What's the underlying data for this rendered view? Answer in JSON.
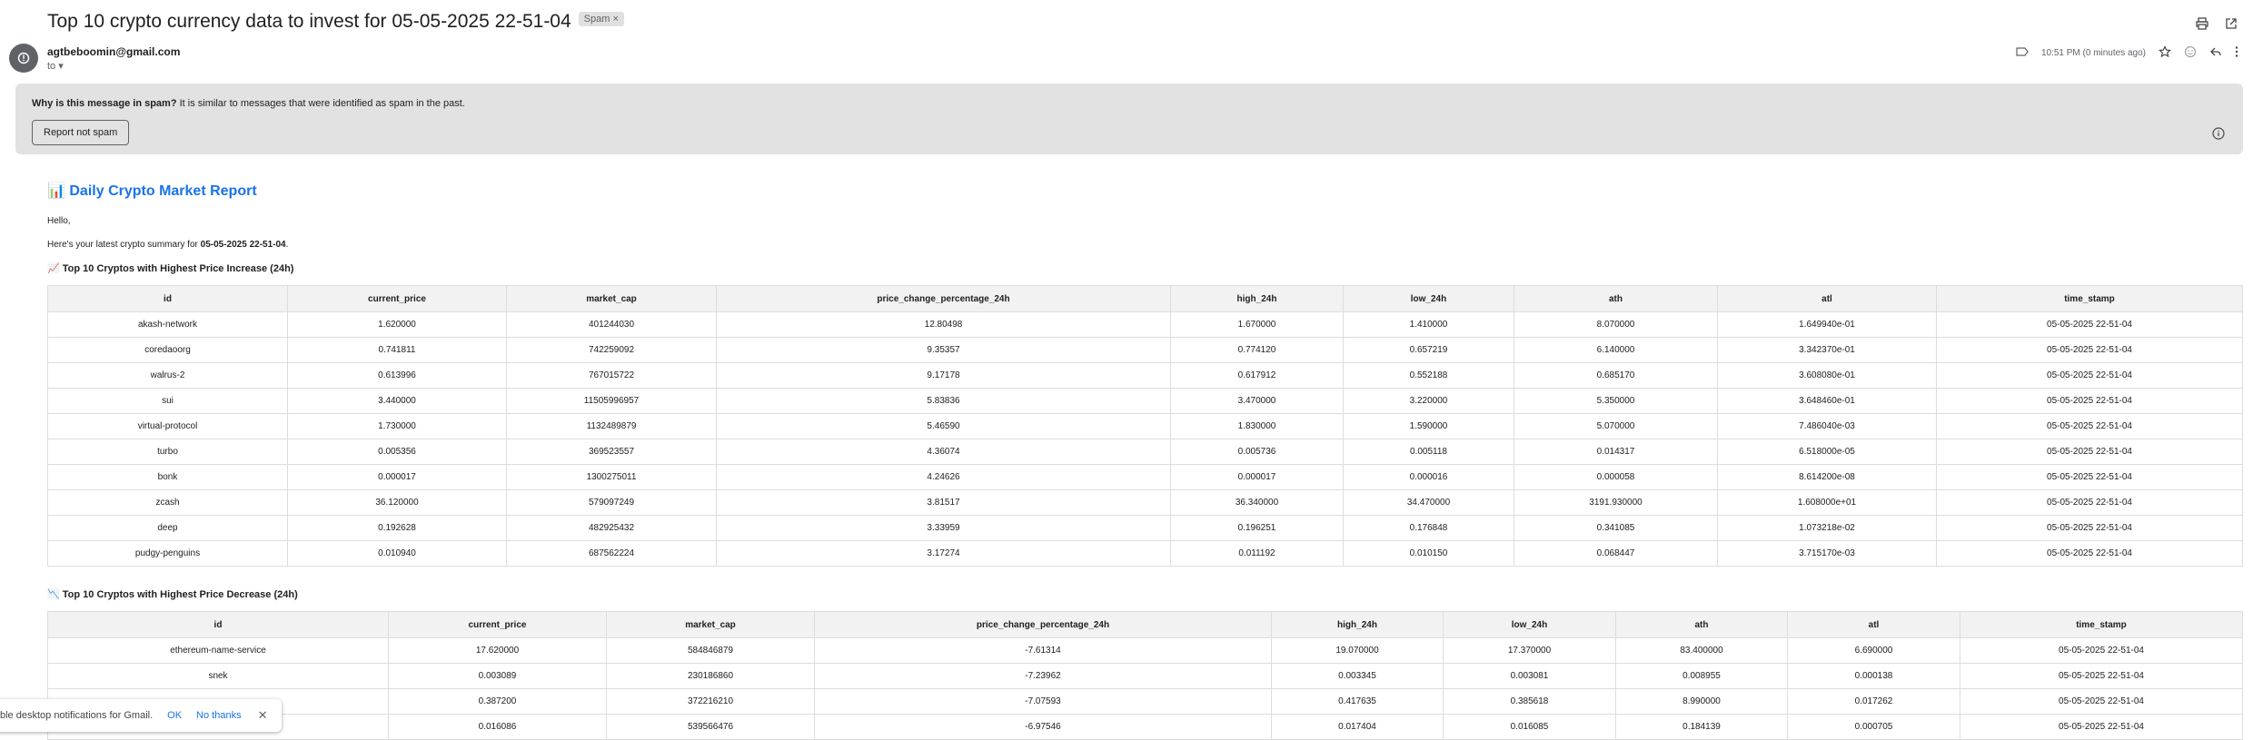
{
  "email": {
    "subject": "Top 10 crypto currency data to invest for 05-05-2025 22-51-04",
    "spam_chip": "Spam",
    "sender": "agtbeboomin@gmail.com",
    "to_label": "to",
    "time": "10:51 PM (0 minutes ago)"
  },
  "spam_notice": {
    "question": "Why is this message in spam?",
    "reason": "It is similar to messages that were identified as spam in the past.",
    "button": "Report not spam"
  },
  "body": {
    "report_icon": "📊",
    "report_title": "Daily Crypto Market Report",
    "greeting": "Hello,",
    "summary_prefix": "Here's your latest crypto summary for",
    "summary_date": "05-05-2025 22-51-04",
    "summary_suffix": "."
  },
  "columns": [
    "id",
    "current_price",
    "market_cap",
    "price_change_percentage_24h",
    "high_24h",
    "low_24h",
    "ath",
    "atl",
    "time_stamp"
  ],
  "increase": {
    "icon": "📈",
    "title": "Top 10 Cryptos with Highest Price Increase (24h)",
    "rows": [
      [
        "akash-network",
        "1.620000",
        "401244030",
        "12.80498",
        "1.670000",
        "1.410000",
        "8.070000",
        "1.649940e-01",
        "05-05-2025 22-51-04"
      ],
      [
        "coredaoorg",
        "0.741811",
        "742259092",
        "9.35357",
        "0.774120",
        "0.657219",
        "6.140000",
        "3.342370e-01",
        "05-05-2025 22-51-04"
      ],
      [
        "walrus-2",
        "0.613996",
        "767015722",
        "9.17178",
        "0.617912",
        "0.552188",
        "0.685170",
        "3.608080e-01",
        "05-05-2025 22-51-04"
      ],
      [
        "sui",
        "3.440000",
        "11505996957",
        "5.83836",
        "3.470000",
        "3.220000",
        "5.350000",
        "3.648460e-01",
        "05-05-2025 22-51-04"
      ],
      [
        "virtual-protocol",
        "1.730000",
        "1132489879",
        "5.46590",
        "1.830000",
        "1.590000",
        "5.070000",
        "7.486040e-03",
        "05-05-2025 22-51-04"
      ],
      [
        "turbo",
        "0.005356",
        "369523557",
        "4.36074",
        "0.005736",
        "0.005118",
        "0.014317",
        "6.518000e-05",
        "05-05-2025 22-51-04"
      ],
      [
        "bonk",
        "0.000017",
        "1300275011",
        "4.24626",
        "0.000017",
        "0.000016",
        "0.000058",
        "8.614200e-08",
        "05-05-2025 22-51-04"
      ],
      [
        "zcash",
        "36.120000",
        "579097249",
        "3.81517",
        "36.340000",
        "34.470000",
        "3191.930000",
        "1.608000e+01",
        "05-05-2025 22-51-04"
      ],
      [
        "deep",
        "0.192628",
        "482925432",
        "3.33959",
        "0.196251",
        "0.176848",
        "0.341085",
        "1.073218e-02",
        "05-05-2025 22-51-04"
      ],
      [
        "pudgy-penguins",
        "0.010940",
        "687562224",
        "3.17274",
        "0.011192",
        "0.010150",
        "0.068447",
        "3.715170e-03",
        "05-05-2025 22-51-04"
      ]
    ]
  },
  "decrease": {
    "icon": "📉",
    "title": "Top 10 Cryptos with Highest Price Decrease (24h)",
    "rows": [
      [
        "ethereum-name-service",
        "17.620000",
        "584846879",
        "-7.61314",
        "19.070000",
        "17.370000",
        "83.400000",
        "6.690000",
        "05-05-2025 22-51-04"
      ],
      [
        "snek",
        "0.003089",
        "230186860",
        "-7.23962",
        "0.003345",
        "0.003081",
        "0.008955",
        "0.000138",
        "05-05-2025 22-51-04"
      ],
      [
        "",
        "0.387200",
        "372216210",
        "-7.07593",
        "0.417635",
        "0.385618",
        "8.990000",
        "0.017262",
        "05-05-2025 22-51-04"
      ],
      [
        "",
        "0.016086",
        "539566476",
        "-6.97546",
        "0.017404",
        "0.016085",
        "0.184139",
        "0.000705",
        "05-05-2025 22-51-04"
      ]
    ]
  },
  "toast": {
    "text": "ble desktop notifications for Gmail.",
    "ok": "OK",
    "no_thanks": "No thanks"
  }
}
